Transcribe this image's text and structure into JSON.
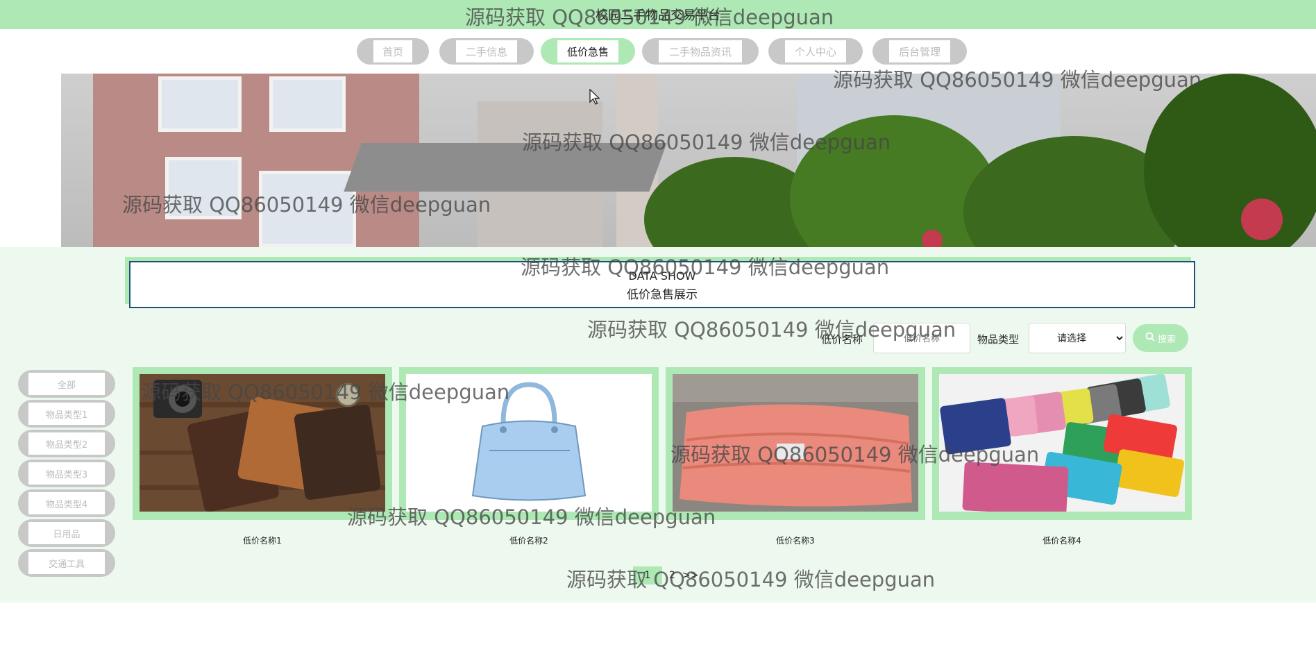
{
  "header": {
    "title": "校园二手物品交易平台"
  },
  "nav": {
    "items": [
      {
        "label": "首页",
        "active": false
      },
      {
        "label": "二手信息",
        "active": false
      },
      {
        "label": "低价急售",
        "active": true
      },
      {
        "label": "二手物品资讯",
        "active": false
      },
      {
        "label": "个人中心",
        "active": false
      },
      {
        "label": "后台管理",
        "active": false
      }
    ]
  },
  "section": {
    "title_en": "DATA SHOW",
    "title_cn": "低价急售展示"
  },
  "search": {
    "name_label": "低价名称",
    "name_placeholder": "低价名称",
    "type_label": "物品类型",
    "type_selected": "请选择",
    "button_label": "搜索"
  },
  "sidebar": {
    "items": [
      {
        "label": "全部"
      },
      {
        "label": "物品类型1"
      },
      {
        "label": "物品类型2"
      },
      {
        "label": "物品类型3"
      },
      {
        "label": "物品类型4"
      },
      {
        "label": "日用品"
      },
      {
        "label": "交通工具"
      }
    ]
  },
  "products": [
    {
      "name": "低价名称1",
      "image": "wallets-with-camera"
    },
    {
      "name": "低价名称2",
      "image": "blue-handbag"
    },
    {
      "name": "低价名称3",
      "image": "pink-quilt"
    },
    {
      "name": "低价名称4",
      "image": "colorful-wallets"
    }
  ],
  "pagination": {
    "current": "1",
    "next": "2",
    "last_arrow": ">>"
  },
  "watermark": "源码获取 QQ86050149 微信deepguan",
  "colors": {
    "accent": "#aee8b4",
    "content_bg": "#edf9ee",
    "nav_gray": "#c8c8c8",
    "frame_border": "#1d4f7b"
  }
}
